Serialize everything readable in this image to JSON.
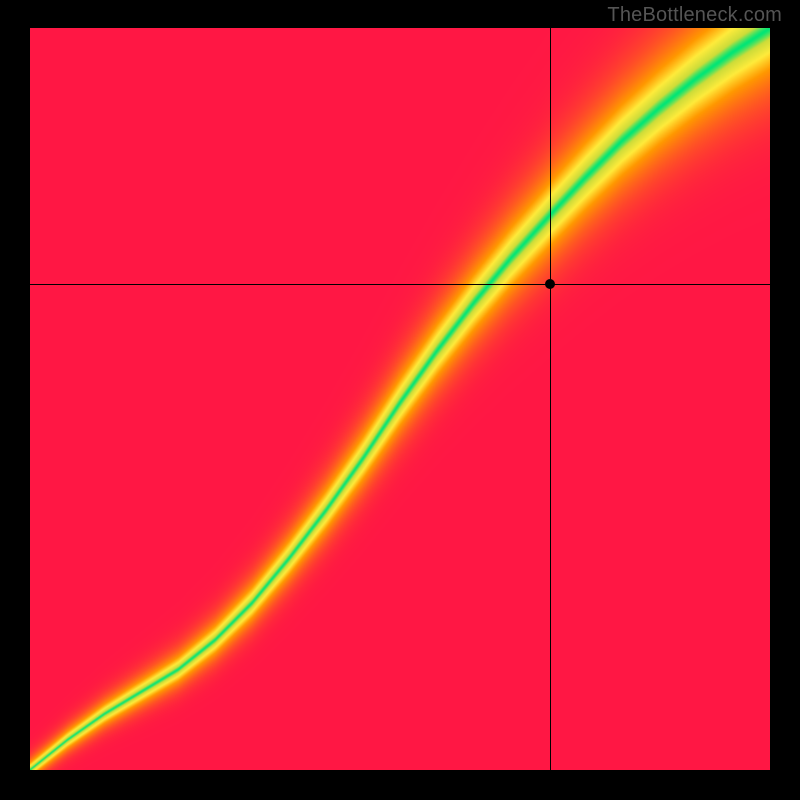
{
  "watermark": "TheBottleneck.com",
  "chart_data": {
    "type": "heatmap",
    "title": "",
    "xlabel": "",
    "ylabel": "",
    "xlim": [
      0,
      1
    ],
    "ylim": [
      0,
      1
    ],
    "crosshair": {
      "x": 0.703,
      "y": 0.655
    },
    "marker": {
      "x": 0.703,
      "y": 0.655
    },
    "ridge_curve": [
      {
        "x": 0.0,
        "y": 0.0
      },
      {
        "x": 0.05,
        "y": 0.04
      },
      {
        "x": 0.1,
        "y": 0.075
      },
      {
        "x": 0.15,
        "y": 0.105
      },
      {
        "x": 0.2,
        "y": 0.135
      },
      {
        "x": 0.25,
        "y": 0.175
      },
      {
        "x": 0.3,
        "y": 0.225
      },
      {
        "x": 0.35,
        "y": 0.285
      },
      {
        "x": 0.4,
        "y": 0.35
      },
      {
        "x": 0.45,
        "y": 0.42
      },
      {
        "x": 0.5,
        "y": 0.495
      },
      {
        "x": 0.55,
        "y": 0.565
      },
      {
        "x": 0.6,
        "y": 0.63
      },
      {
        "x": 0.65,
        "y": 0.69
      },
      {
        "x": 0.7,
        "y": 0.745
      },
      {
        "x": 0.75,
        "y": 0.798
      },
      {
        "x": 0.8,
        "y": 0.848
      },
      {
        "x": 0.85,
        "y": 0.892
      },
      {
        "x": 0.9,
        "y": 0.932
      },
      {
        "x": 0.95,
        "y": 0.968
      },
      {
        "x": 1.0,
        "y": 1.0
      }
    ],
    "band_width": {
      "near_origin": 0.02,
      "far_corner": 0.12
    },
    "color_stops": [
      {
        "t": 0.0,
        "color": "#ff1744"
      },
      {
        "t": 0.25,
        "color": "#ff5722"
      },
      {
        "t": 0.5,
        "color": "#ff9800"
      },
      {
        "t": 0.72,
        "color": "#ffeb3b"
      },
      {
        "t": 0.9,
        "color": "#cddc39"
      },
      {
        "t": 1.0,
        "color": "#00e676"
      }
    ]
  }
}
